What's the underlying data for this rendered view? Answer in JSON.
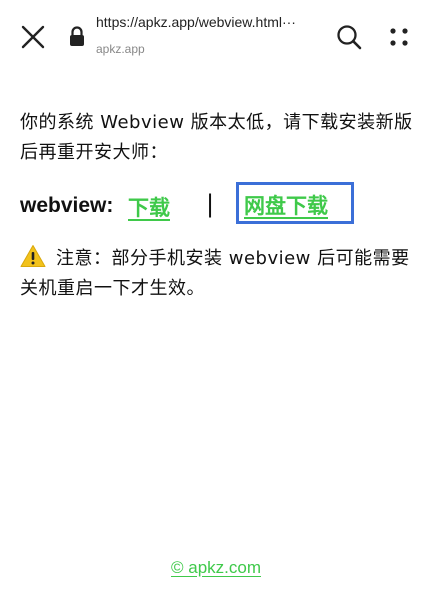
{
  "toolbar": {
    "url": "https://apkz.app/webview.html···",
    "host": "apkz.app",
    "icons": {
      "close": "close-icon",
      "lock": "lock-icon",
      "search": "search-icon",
      "menu": "more-icon"
    }
  },
  "content": {
    "notice": "你的系统 Webview 版本太低，请下载安装新版后再重开安大师：",
    "download": {
      "label": "webview:",
      "link1": "下载",
      "separator": "|",
      "link2": "网盘下载"
    },
    "warning": "注意：部分手机安装 webview 后可能需要关机重启一下才生效。"
  },
  "footer": {
    "text": "© apkz.com"
  },
  "colors": {
    "link": "#3fc94a",
    "highlight_box": "#3b6fd8",
    "warning_icon": "#f2c21b"
  }
}
